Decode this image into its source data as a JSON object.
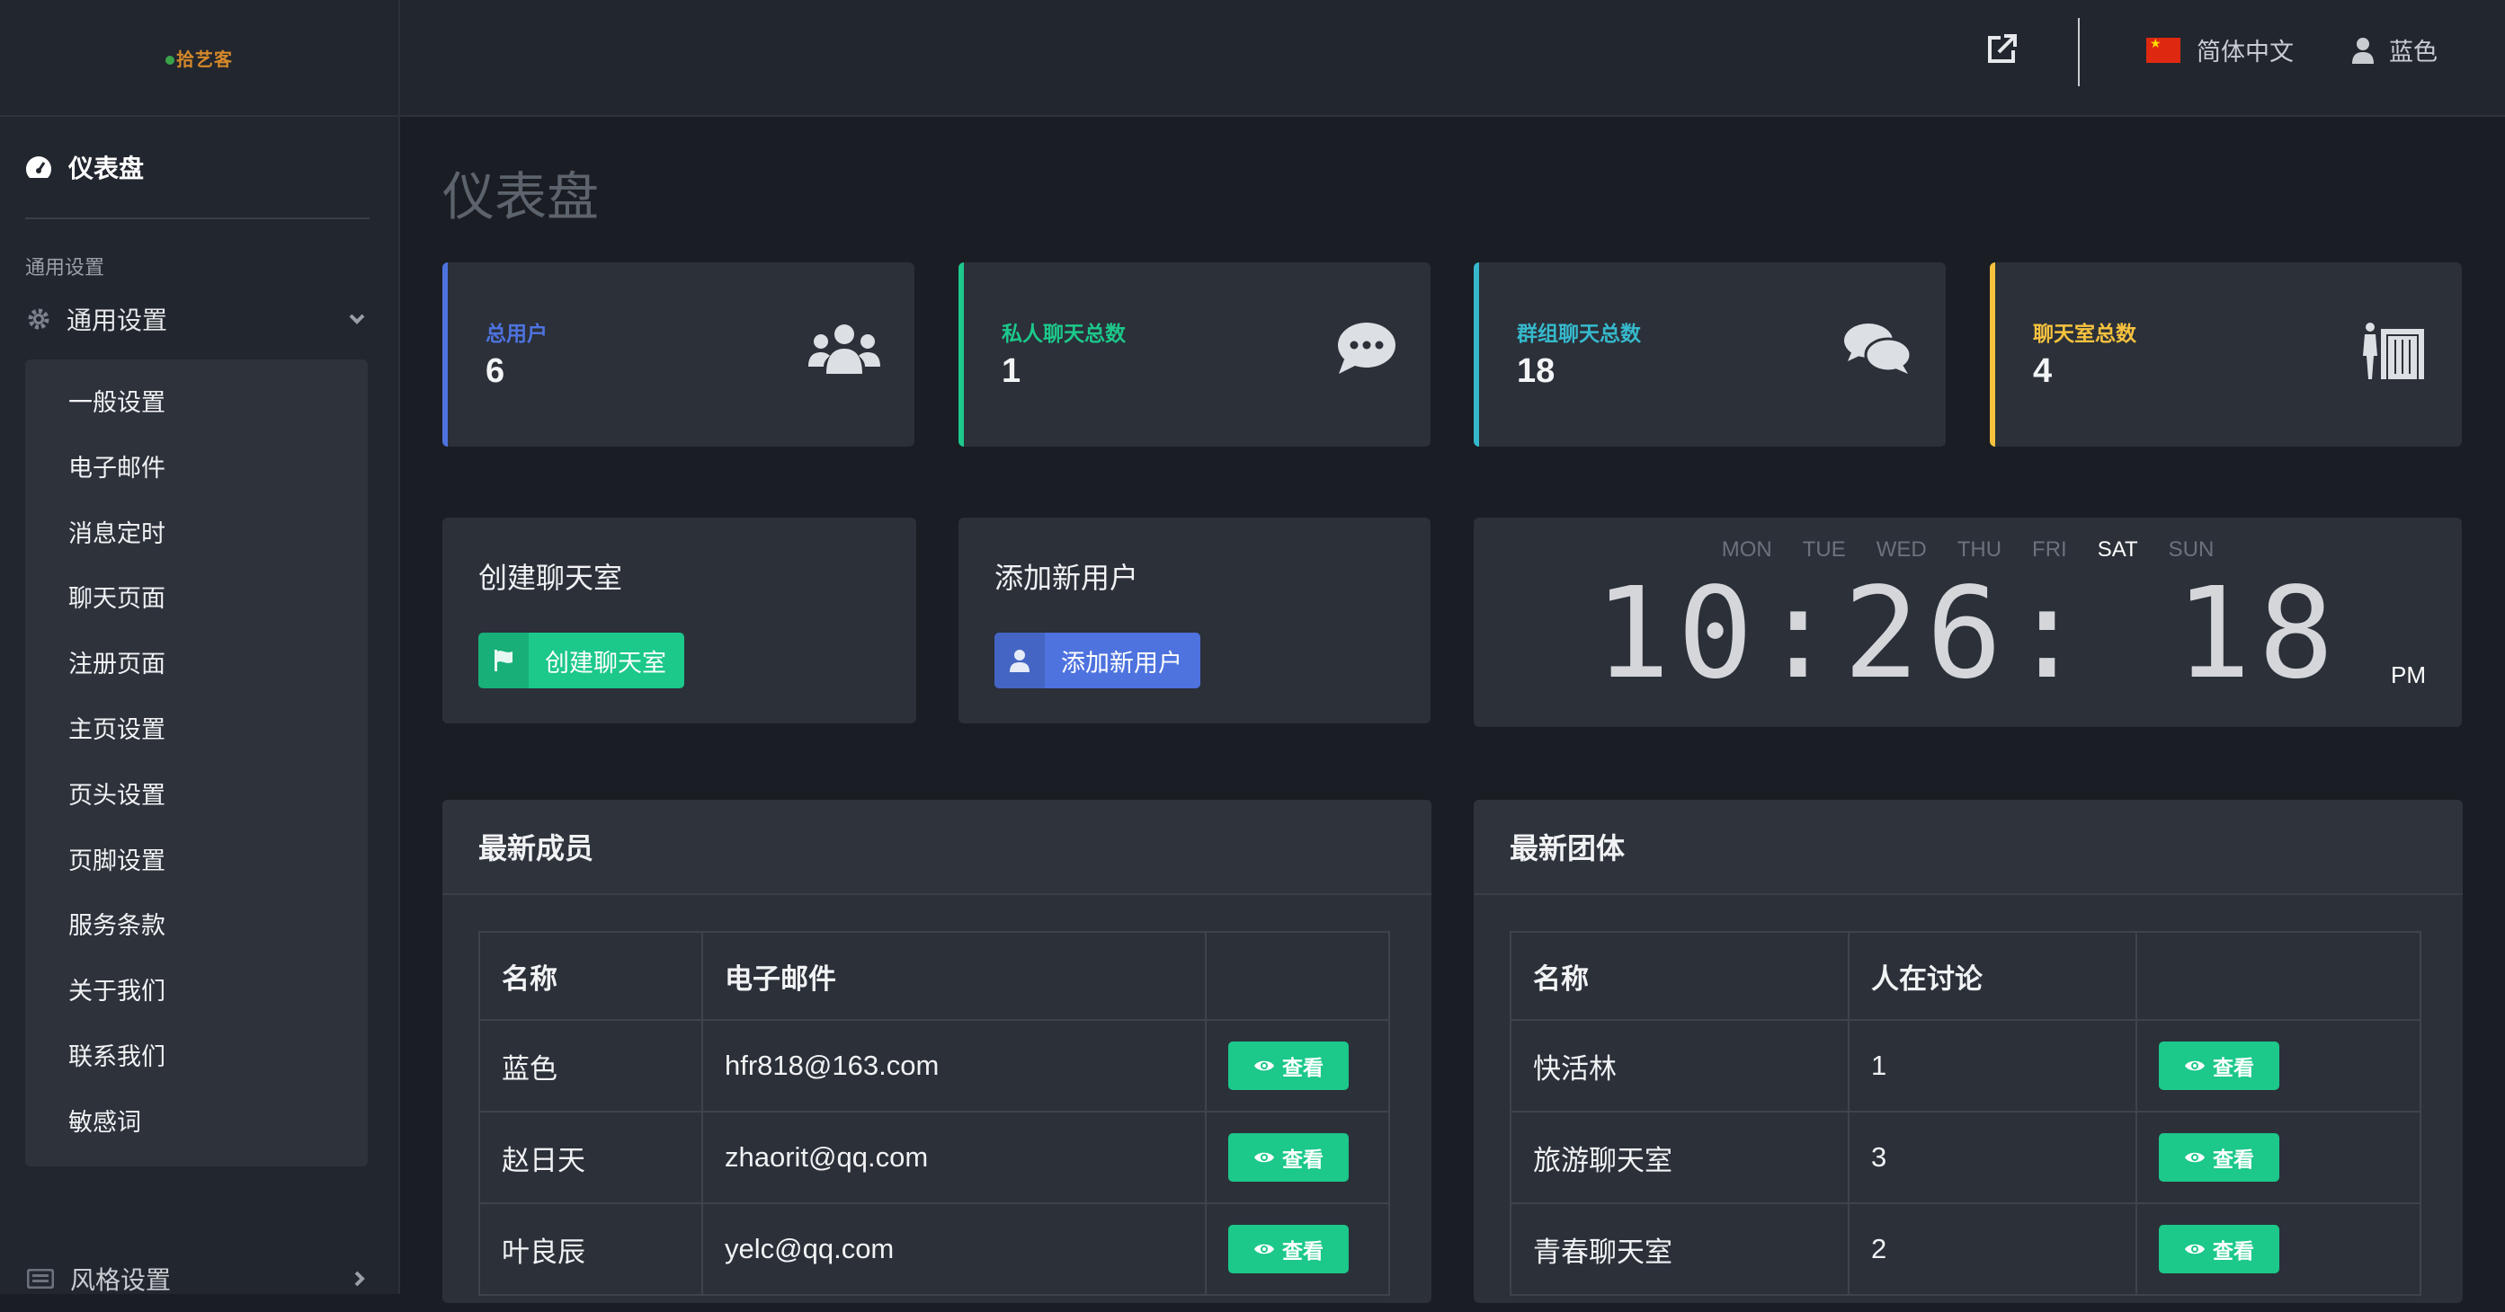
{
  "sidebar": {
    "logo_text": "拾艺客",
    "dashboard_label": "仪表盘",
    "section_heading": "通用设置",
    "general_group_label": "通用设置",
    "sub_items": [
      {
        "label": "一般设置"
      },
      {
        "label": "电子邮件"
      },
      {
        "label": "消息定时"
      },
      {
        "label": "聊天页面"
      },
      {
        "label": "注册页面"
      },
      {
        "label": "主页设置"
      },
      {
        "label": "页头设置"
      },
      {
        "label": "页脚设置"
      },
      {
        "label": "服务条款"
      },
      {
        "label": "关于我们"
      },
      {
        "label": "联系我们"
      },
      {
        "label": "敏感词"
      }
    ],
    "style_group_label": "风格设置"
  },
  "topbar": {
    "language_label": "简体中文",
    "username": "蓝色",
    "icons": [
      "external-link-icon",
      "flag-cn-icon",
      "user-icon"
    ]
  },
  "page_title": "仪表盘",
  "stats": [
    {
      "title": "总用户",
      "value": "6",
      "color": "#4e73df",
      "icon": "users-icon"
    },
    {
      "title": "私人聊天总数",
      "value": "1",
      "color": "#1cc88a",
      "icon": "comment-icon"
    },
    {
      "title": "群组聊天总数",
      "value": "18",
      "color": "#36b9cc",
      "icon": "comments-icon"
    },
    {
      "title": "聊天室总数",
      "value": "4",
      "color": "#f6c23e",
      "icon": "door-icon"
    }
  ],
  "create_room": {
    "title": "创建聊天室",
    "button_label": "创建聊天室"
  },
  "add_user": {
    "title": "添加新用户",
    "button_label": "添加新用户"
  },
  "clock": {
    "days": [
      "MON",
      "TUE",
      "WED",
      "THU",
      "FRI",
      "SAT",
      "SUN"
    ],
    "active_day": "SAT",
    "time": "10:26: 18",
    "ampm": "PM"
  },
  "latest_members": {
    "title": "最新成员",
    "headers": [
      "名称",
      "电子邮件"
    ],
    "rows": [
      {
        "name": "蓝色",
        "email": "hfr818@163.com",
        "action": "查看"
      },
      {
        "name": "赵日天",
        "email": "zhaorit@qq.com",
        "action": "查看"
      },
      {
        "name": "叶良辰",
        "email": "yelc@qq.com",
        "action": "查看"
      }
    ]
  },
  "latest_groups": {
    "title": "最新团体",
    "headers": [
      "名称",
      "人在讨论"
    ],
    "rows": [
      {
        "name": "快活林",
        "count": "1",
        "action": "查看"
      },
      {
        "name": "旅游聊天室",
        "count": "3",
        "action": "查看"
      },
      {
        "name": "青春聊天室",
        "count": "2",
        "action": "查看"
      }
    ]
  }
}
